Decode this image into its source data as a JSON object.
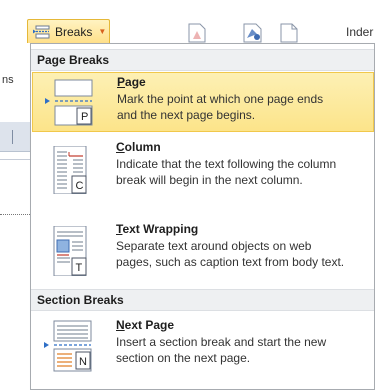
{
  "ribbon": {
    "breaks_label": "Breaks",
    "indent_label": "Inder",
    "left_edge_text": "ns"
  },
  "menu": {
    "sections": [
      {
        "label": "Page Breaks"
      },
      {
        "label": "Section Breaks"
      }
    ],
    "items": [
      {
        "accel": "P",
        "rest": "age",
        "desc_line1": "Mark the point at which one page ends",
        "desc_line2": "and the next page begins.",
        "icon_letter": "P",
        "icon": "page-break-icon"
      },
      {
        "accel": "C",
        "rest": "olumn",
        "desc_line1": "Indicate that the text following the column",
        "desc_line2": "break will begin in the next column.",
        "icon_letter": "C",
        "icon": "column-break-icon"
      },
      {
        "accel": "T",
        "rest": "ext Wrapping",
        "desc_line1": "Separate text around objects on web",
        "desc_line2": "pages, such as caption text from body text.",
        "icon_letter": "T",
        "icon": "text-wrapping-icon"
      },
      {
        "accel": "N",
        "rest": "ext Page",
        "desc_line1": "Insert a section break and start the new",
        "desc_line2": "section on the next page.",
        "icon_letter": "N",
        "icon": "next-page-icon"
      }
    ]
  },
  "colors": {
    "hover_fill": "#fce48a",
    "hover_border": "#f1c84b",
    "accent_arrow": "#2f6fc6",
    "section_header_bg": "#eef0f2"
  }
}
